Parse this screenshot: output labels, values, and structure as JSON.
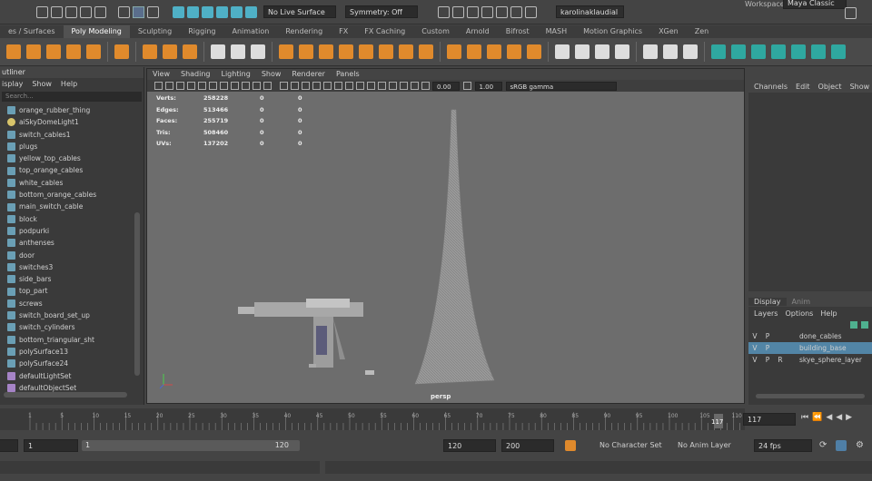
{
  "status_line": {
    "workspace_label": "Workspace:",
    "workspace_value": "Maya Classic",
    "live_surface": "No Live Surface",
    "symmetry": "Symmetry: Off",
    "user": "karolinaklaudial"
  },
  "shelf": {
    "tabs": [
      "es / Surfaces",
      "Poly Modeling",
      "Sculpting",
      "Rigging",
      "Animation",
      "Rendering",
      "FX",
      "FX Caching",
      "Custom",
      "Arnold",
      "Bifrost",
      "MASH",
      "Motion Graphics",
      "XGen",
      "Zen"
    ],
    "active_index": 1
  },
  "outliner": {
    "title": "utliner",
    "menu": [
      "isplay",
      "Show",
      "Help"
    ],
    "search_placeholder": "Search...",
    "items": [
      {
        "label": "orange_rubber_thing",
        "type": "mesh"
      },
      {
        "label": "aiSkyDomeLight1",
        "type": "light"
      },
      {
        "label": "switch_cables1",
        "type": "mesh"
      },
      {
        "label": "plugs",
        "type": "mesh"
      },
      {
        "label": "yellow_top_cables",
        "type": "mesh"
      },
      {
        "label": "top_orange_cables",
        "type": "mesh"
      },
      {
        "label": "white_cables",
        "type": "mesh"
      },
      {
        "label": "bottom_orange_cables",
        "type": "mesh"
      },
      {
        "label": "main_switch_cable",
        "type": "mesh"
      },
      {
        "label": "block",
        "type": "mesh"
      },
      {
        "label": "podpurki",
        "type": "mesh"
      },
      {
        "label": "anthenses",
        "type": "mesh"
      },
      {
        "label": "door",
        "type": "mesh"
      },
      {
        "label": "switches3",
        "type": "mesh"
      },
      {
        "label": "side_bars",
        "type": "mesh"
      },
      {
        "label": "top_part",
        "type": "mesh"
      },
      {
        "label": "screws",
        "type": "mesh"
      },
      {
        "label": "switch_board_set_up",
        "type": "mesh"
      },
      {
        "label": "switch_cylinders",
        "type": "mesh"
      },
      {
        "label": "bottom_triangular_sht",
        "type": "mesh"
      },
      {
        "label": "polySurface13",
        "type": "mesh"
      },
      {
        "label": "polySurface24",
        "type": "mesh"
      },
      {
        "label": "defaultLightSet",
        "type": "set"
      },
      {
        "label": "defaultObjectSet",
        "type": "set"
      }
    ]
  },
  "viewport": {
    "menu": [
      "View",
      "Shading",
      "Lighting",
      "Show",
      "Renderer",
      "Panels"
    ],
    "toolbar_value1": "0.00",
    "toolbar_value2": "1.00",
    "color_space": "sRGB gamma",
    "camera_label": "persp",
    "hud": [
      {
        "label": "Verts:",
        "v1": "258228",
        "v2": "0",
        "v3": "0"
      },
      {
        "label": "Edges:",
        "v1": "513466",
        "v2": "0",
        "v3": "0"
      },
      {
        "label": "Faces:",
        "v1": "255719",
        "v2": "0",
        "v3": "0"
      },
      {
        "label": "Tris:",
        "v1": "508460",
        "v2": "0",
        "v3": "0"
      },
      {
        "label": "UVs:",
        "v1": "137202",
        "v2": "0",
        "v3": "0"
      }
    ]
  },
  "channel_box": {
    "menu": [
      "Channels",
      "Edit",
      "Object",
      "Show"
    ]
  },
  "layer_editor": {
    "tabs": [
      "Display",
      "Anim"
    ],
    "menu": [
      "Layers",
      "Options",
      "Help"
    ],
    "layers": [
      {
        "v": "V",
        "p": "P",
        "r": "",
        "name": "done_cables",
        "selected": false
      },
      {
        "v": "V",
        "p": "P",
        "r": "",
        "name": "building_base",
        "selected": true
      },
      {
        "v": "V",
        "p": "P",
        "r": "R",
        "name": "skye_sphere_layer",
        "selected": false
      }
    ]
  },
  "time_slider": {
    "ticks": [
      "1",
      "5",
      "10",
      "15",
      "20",
      "25",
      "30",
      "35",
      "40",
      "45",
      "50",
      "55",
      "60",
      "65",
      "70",
      "75",
      "80",
      "85",
      "90",
      "95",
      "100",
      "105",
      "110",
      "115",
      "12"
    ],
    "current_frame_marker": "117",
    "current_frame": "117"
  },
  "range_slider": {
    "start": "1",
    "range_start": "1",
    "range_start_inner": "1",
    "range_end_inner": "120",
    "range_end": "120",
    "end": "200",
    "character_set": "No Character Set",
    "anim_layer": "No Anim Layer",
    "fps": "24 fps"
  }
}
